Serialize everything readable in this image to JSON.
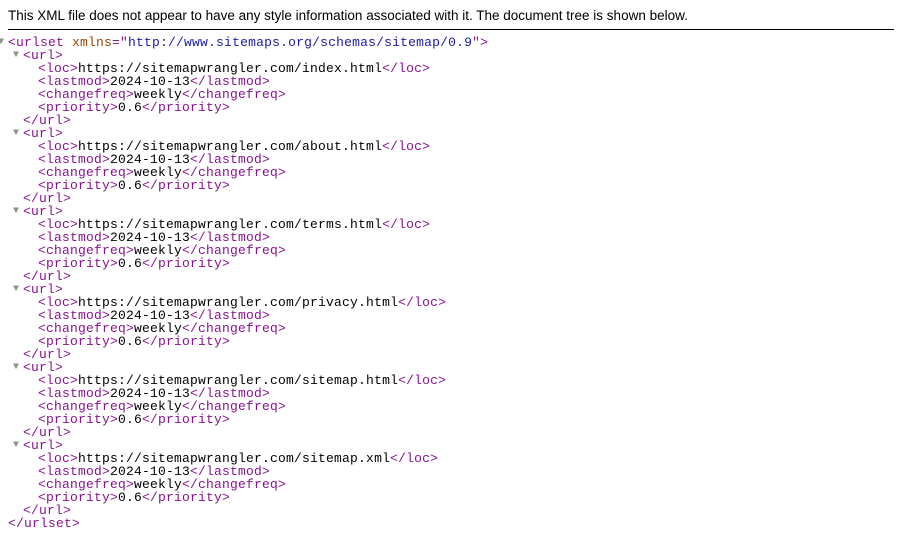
{
  "notice": "This XML file does not appear to have any style information associated with it. The document tree is shown below.",
  "root": {
    "tag": "urlset",
    "attr_name": "xmlns",
    "attr_value": "http://www.sitemaps.org/schemas/sitemap/0.9"
  },
  "entries": [
    {
      "loc": "https://sitemapwrangler.com/index.html",
      "lastmod": "2024-10-13",
      "changefreq": "weekly",
      "priority": "0.6"
    },
    {
      "loc": "https://sitemapwrangler.com/about.html",
      "lastmod": "2024-10-13",
      "changefreq": "weekly",
      "priority": "0.6"
    },
    {
      "loc": "https://sitemapwrangler.com/terms.html",
      "lastmod": "2024-10-13",
      "changefreq": "weekly",
      "priority": "0.6"
    },
    {
      "loc": "https://sitemapwrangler.com/privacy.html",
      "lastmod": "2024-10-13",
      "changefreq": "weekly",
      "priority": "0.6"
    },
    {
      "loc": "https://sitemapwrangler.com/sitemap.html",
      "lastmod": "2024-10-13",
      "changefreq": "weekly",
      "priority": "0.6"
    },
    {
      "loc": "https://sitemapwrangler.com/sitemap.xml",
      "lastmod": "2024-10-13",
      "changefreq": "weekly",
      "priority": "0.6"
    }
  ]
}
